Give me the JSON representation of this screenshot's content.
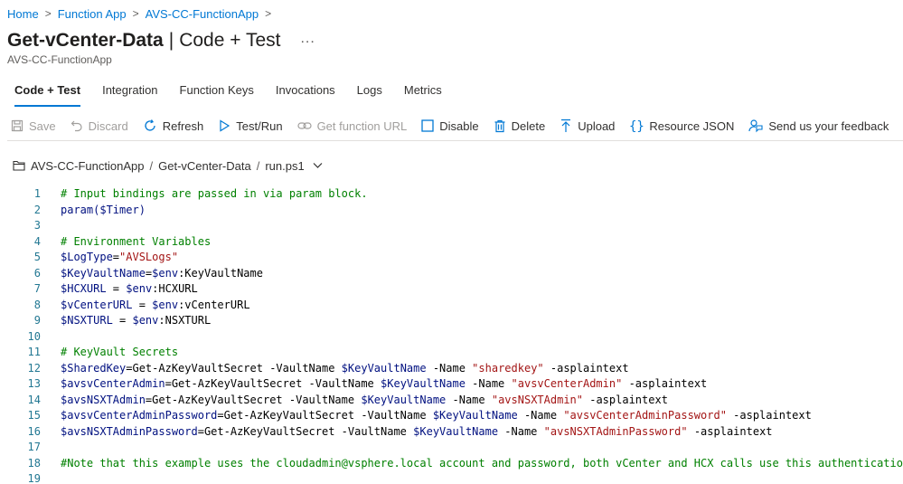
{
  "breadcrumb": {
    "items": [
      "Home",
      "Function App",
      "AVS-CC-FunctionApp"
    ],
    "separator": ">"
  },
  "header": {
    "title": "Get-vCenter-Data",
    "divider": "|",
    "section": "Code + Test",
    "more": "...",
    "subtitle": "AVS-CC-FunctionApp"
  },
  "tabs": [
    {
      "label": "Code + Test",
      "active": true
    },
    {
      "label": "Integration",
      "active": false
    },
    {
      "label": "Function Keys",
      "active": false
    },
    {
      "label": "Invocations",
      "active": false
    },
    {
      "label": "Logs",
      "active": false
    },
    {
      "label": "Metrics",
      "active": false
    }
  ],
  "toolbar": {
    "save": "Save",
    "discard": "Discard",
    "refresh": "Refresh",
    "test_run": "Test/Run",
    "get_function_url": "Get function URL",
    "disable": "Disable",
    "delete": "Delete",
    "upload": "Upload",
    "resource_json": "Resource JSON",
    "feedback": "Send us your feedback"
  },
  "file_path": {
    "app": "AVS-CC-FunctionApp",
    "function": "Get-vCenter-Data",
    "file": "run.ps1",
    "separator": "/"
  },
  "colors": {
    "accent": "#0078d4",
    "comment": "#008000",
    "variable": "#001080",
    "string": "#a31515",
    "line_number": "#237893"
  },
  "editor": {
    "lines": [
      {
        "n": "1",
        "tokens": [
          [
            "c",
            "# Input bindings are passed in via param block."
          ]
        ]
      },
      {
        "n": "2",
        "tokens": [
          [
            "v",
            "param($Timer)"
          ]
        ]
      },
      {
        "n": "3",
        "tokens": []
      },
      {
        "n": "4",
        "tokens": [
          [
            "c",
            "# Environment Variables"
          ]
        ]
      },
      {
        "n": "5",
        "tokens": [
          [
            "v",
            "$LogType"
          ],
          [
            "p",
            "="
          ],
          [
            "s",
            "\"AVSLogs\""
          ]
        ]
      },
      {
        "n": "6",
        "tokens": [
          [
            "v",
            "$KeyVaultName"
          ],
          [
            "p",
            "="
          ],
          [
            "v",
            "$env"
          ],
          [
            "p",
            ":KeyVaultName"
          ]
        ]
      },
      {
        "n": "7",
        "tokens": [
          [
            "v",
            "$HCXURL"
          ],
          [
            "p",
            " = "
          ],
          [
            "v",
            "$env"
          ],
          [
            "p",
            ":HCXURL"
          ]
        ]
      },
      {
        "n": "8",
        "tokens": [
          [
            "v",
            "$vCenterURL"
          ],
          [
            "p",
            " = "
          ],
          [
            "v",
            "$env"
          ],
          [
            "p",
            ":vCenterURL"
          ]
        ]
      },
      {
        "n": "9",
        "tokens": [
          [
            "v",
            "$NSXTURL"
          ],
          [
            "p",
            " = "
          ],
          [
            "v",
            "$env"
          ],
          [
            "p",
            ":NSXTURL"
          ]
        ]
      },
      {
        "n": "10",
        "tokens": []
      },
      {
        "n": "11",
        "tokens": [
          [
            "c",
            "# KeyVault Secrets"
          ]
        ]
      },
      {
        "n": "12",
        "tokens": [
          [
            "v",
            "$SharedKey"
          ],
          [
            "p",
            "=Get-AzKeyVaultSecret -VaultName "
          ],
          [
            "v",
            "$KeyVaultName"
          ],
          [
            "p",
            " -Name "
          ],
          [
            "s",
            "\"sharedkey\""
          ],
          [
            "p",
            " -asplaintext"
          ]
        ]
      },
      {
        "n": "13",
        "tokens": [
          [
            "v",
            "$avsvCenterAdmin"
          ],
          [
            "p",
            "=Get-AzKeyVaultSecret -VaultName "
          ],
          [
            "v",
            "$KeyVaultName"
          ],
          [
            "p",
            " -Name "
          ],
          [
            "s",
            "\"avsvCenterAdmin\""
          ],
          [
            "p",
            " -asplaintext"
          ]
        ]
      },
      {
        "n": "14",
        "tokens": [
          [
            "v",
            "$avsNSXTAdmin"
          ],
          [
            "p",
            "=Get-AzKeyVaultSecret -VaultName "
          ],
          [
            "v",
            "$KeyVaultName"
          ],
          [
            "p",
            " -Name "
          ],
          [
            "s",
            "\"avsNSXTAdmin\""
          ],
          [
            "p",
            " -asplaintext"
          ]
        ]
      },
      {
        "n": "15",
        "tokens": [
          [
            "v",
            "$avsvCenterAdminPassword"
          ],
          [
            "p",
            "=Get-AzKeyVaultSecret -VaultName "
          ],
          [
            "v",
            "$KeyVaultName"
          ],
          [
            "p",
            " -Name "
          ],
          [
            "s",
            "\"avsvCenterAdminPassword\""
          ],
          [
            "p",
            " -asplaintext"
          ]
        ]
      },
      {
        "n": "16",
        "tokens": [
          [
            "v",
            "$avsNSXTAdminPassword"
          ],
          [
            "p",
            "=Get-AzKeyVaultSecret -VaultName "
          ],
          [
            "v",
            "$KeyVaultName"
          ],
          [
            "p",
            " -Name "
          ],
          [
            "s",
            "\"avsNSXTAdminPassword\""
          ],
          [
            "p",
            " -asplaintext"
          ]
        ]
      },
      {
        "n": "17",
        "tokens": []
      },
      {
        "n": "18",
        "tokens": [
          [
            "c",
            "#Note that this example uses the cloudadmin@vsphere.local account and password, both vCenter and HCX calls use this authentication"
          ]
        ]
      },
      {
        "n": "19",
        "tokens": []
      }
    ]
  }
}
